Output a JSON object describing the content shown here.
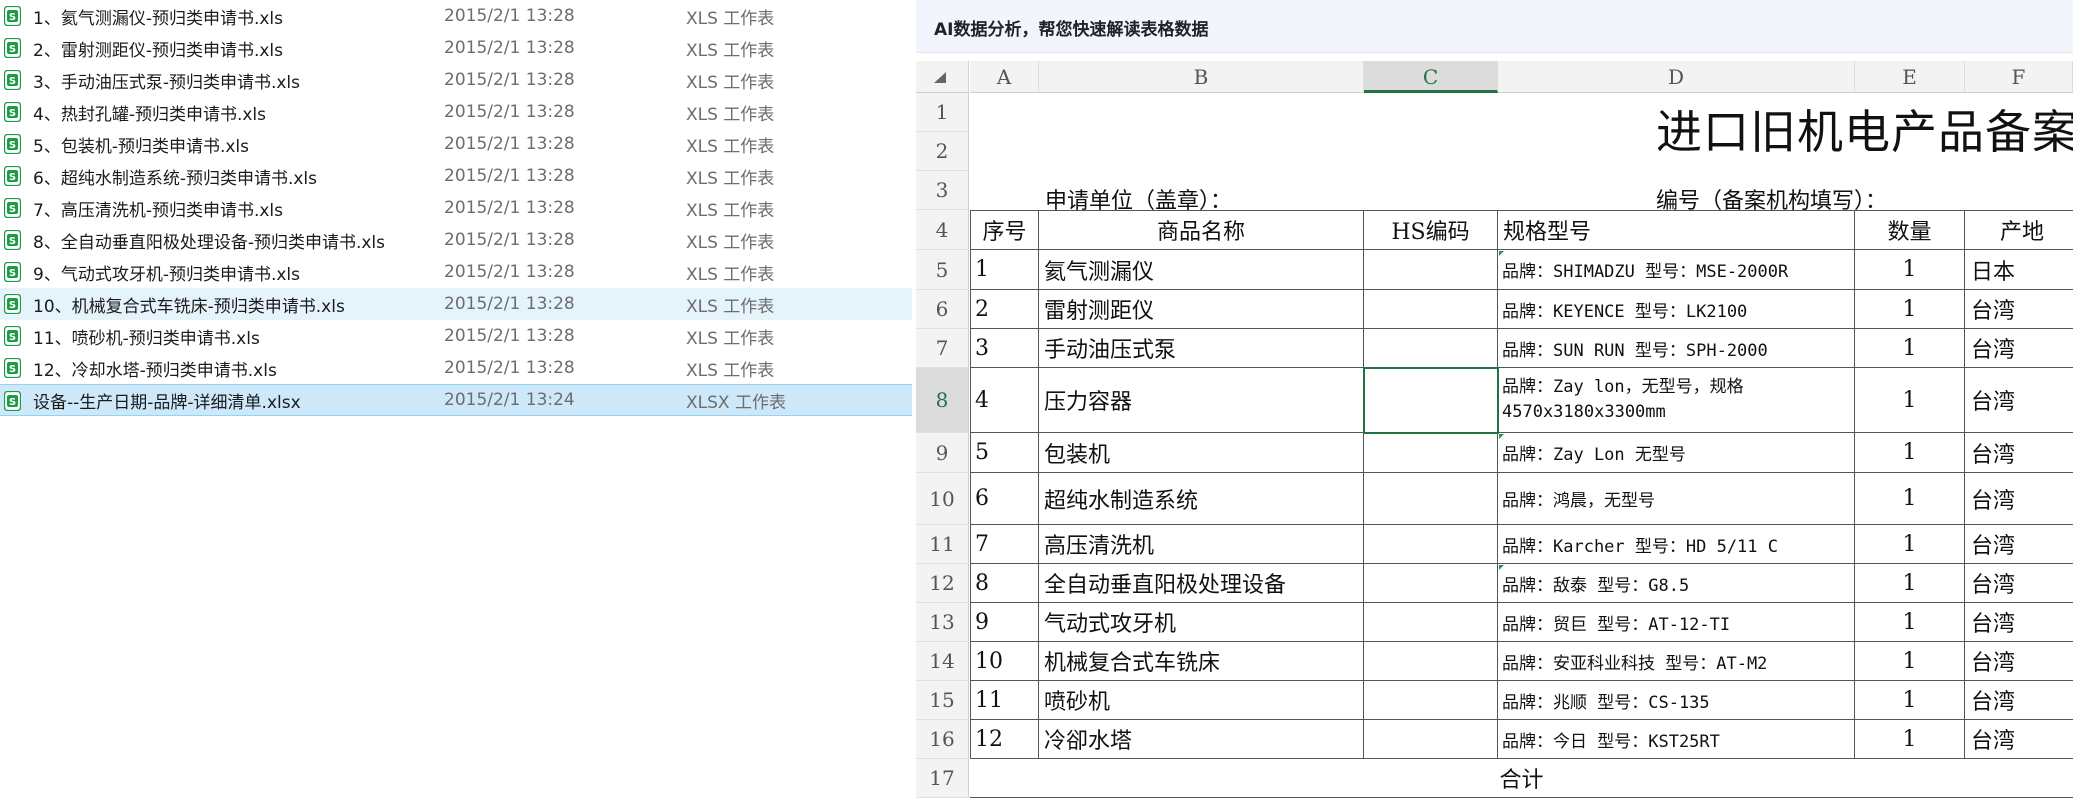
{
  "file_list": [
    {
      "name": "1、氦气测漏仪-预归类申请书.xls",
      "date": "2015/2/1 13:28",
      "type": "XLS 工作表"
    },
    {
      "name": "2、雷射测距仪-预归类申请书.xls",
      "date": "2015/2/1 13:28",
      "type": "XLS 工作表"
    },
    {
      "name": "3、手动油压式泵-预归类申请书.xls",
      "date": "2015/2/1 13:28",
      "type": "XLS 工作表"
    },
    {
      "name": "4、热封孔罐-预归类申请书.xls",
      "date": "2015/2/1 13:28",
      "type": "XLS 工作表"
    },
    {
      "name": "5、包装机-预归类申请书.xls",
      "date": "2015/2/1 13:28",
      "type": "XLS 工作表"
    },
    {
      "name": "6、超纯水制造系统-预归类申请书.xls",
      "date": "2015/2/1 13:28",
      "type": "XLS 工作表"
    },
    {
      "name": "7、高压清洗机-预归类申请书.xls",
      "date": "2015/2/1 13:28",
      "type": "XLS 工作表"
    },
    {
      "name": "8、全自动垂直阳极处理设备-预归类申请书.xls",
      "date": "2015/2/1 13:28",
      "type": "XLS 工作表"
    },
    {
      "name": "9、气动式攻牙机-预归类申请书.xls",
      "date": "2015/2/1 13:28",
      "type": "XLS 工作表"
    },
    {
      "name": "10、机械复合式车铣床-预归类申请书.xls",
      "date": "2015/2/1 13:28",
      "type": "XLS 工作表",
      "state": "hover"
    },
    {
      "name": "11、喷砂机-预归类申请书.xls",
      "date": "2015/2/1 13:28",
      "type": "XLS 工作表"
    },
    {
      "name": "12、冷却水塔-预归类申请书.xls",
      "date": "2015/2/1 13:28",
      "type": "XLS 工作表"
    },
    {
      "name": "设备--生产日期-品牌-详细清单.xlsx",
      "date": "2015/2/1 13:24",
      "type": "XLSX 工作表",
      "state": "selected"
    }
  ],
  "ai_bar": {
    "text": "AI数据分析，帮您快速解读表格数据"
  },
  "columns": [
    "A",
    "B",
    "C",
    "D",
    "E",
    "F"
  ],
  "active_column": "C",
  "row_numbers": [
    "1",
    "2",
    "3",
    "4",
    "5",
    "6",
    "7",
    "8",
    "9",
    "10",
    "11",
    "12",
    "13",
    "14",
    "15",
    "16",
    "17"
  ],
  "active_row": "8",
  "sheet": {
    "title": "进口旧机电产品备案",
    "applicant_label": "申请单位（盖章）：",
    "record_no_label": "编号（备案机构填写）：",
    "headers": {
      "seq": "序号",
      "name": "商品名称",
      "hs": "HS编码",
      "spec": "规格型号",
      "qty": "数量",
      "origin": "产地"
    },
    "rows": [
      {
        "seq": "1",
        "name": "氦气测漏仪",
        "hs": "",
        "spec": "品牌：SHIMADZU 型号：MSE-2000R",
        "qty": "1",
        "origin": "日本"
      },
      {
        "seq": "2",
        "name": "雷射测距仪",
        "hs": "",
        "spec": "品牌：KEYENCE 型号：LK2100",
        "qty": "1",
        "origin": "台湾"
      },
      {
        "seq": "3",
        "name": "手动油压式泵",
        "hs": "",
        "spec": "品牌：SUN RUN 型号：SPH-2000",
        "qty": "1",
        "origin": "台湾"
      },
      {
        "seq": "4",
        "name": "压力容器",
        "hs": "",
        "spec": "品牌：Zay lon，无型号，规格4570x3180x3300mm",
        "qty": "1",
        "origin": "台湾"
      },
      {
        "seq": "5",
        "name": "包装机",
        "hs": "",
        "spec": "品牌：Zay Lon 无型号",
        "qty": "1",
        "origin": "台湾"
      },
      {
        "seq": "6",
        "name": "超纯水制造系统",
        "hs": "",
        "spec": "品牌：鸿晨，无型号",
        "qty": "1",
        "origin": "台湾"
      },
      {
        "seq": "7",
        "name": "高压清洗机",
        "hs": "",
        "spec": "品牌：Karcher  型号：HD 5/11 C",
        "qty": "1",
        "origin": "台湾"
      },
      {
        "seq": "8",
        "name": "全自动垂直阳极处理设备",
        "hs": "",
        "spec": "品牌：敌泰  型号：G8.5",
        "qty": "1",
        "origin": "台湾"
      },
      {
        "seq": "9",
        "name": "气动式攻牙机",
        "hs": "",
        "spec": "品牌：贸巨  型号：AT-12-TI",
        "qty": "1",
        "origin": "台湾"
      },
      {
        "seq": "10",
        "name": "机械复合式车铣床",
        "hs": "",
        "spec": "品牌：安亚科业科技 型号：AT-M2",
        "qty": "1",
        "origin": "台湾"
      },
      {
        "seq": "11",
        "name": "喷砂机",
        "hs": "",
        "spec": "品牌：兆顺  型号：CS-135",
        "qty": "1",
        "origin": "台湾"
      },
      {
        "seq": "12",
        "name": "冷卻水塔",
        "hs": "",
        "spec": "品牌：今日  型号：KST25RT",
        "qty": "1",
        "origin": "台湾"
      }
    ],
    "total_label": "合计"
  },
  "colors": {
    "accent": "#217346",
    "selection": "#cce8f9",
    "hover": "#e5f3fb",
    "icon": "#1e9b48"
  },
  "icons": {
    "file": "spreadsheet-file-icon",
    "corner": "select-all-triangle-icon"
  }
}
